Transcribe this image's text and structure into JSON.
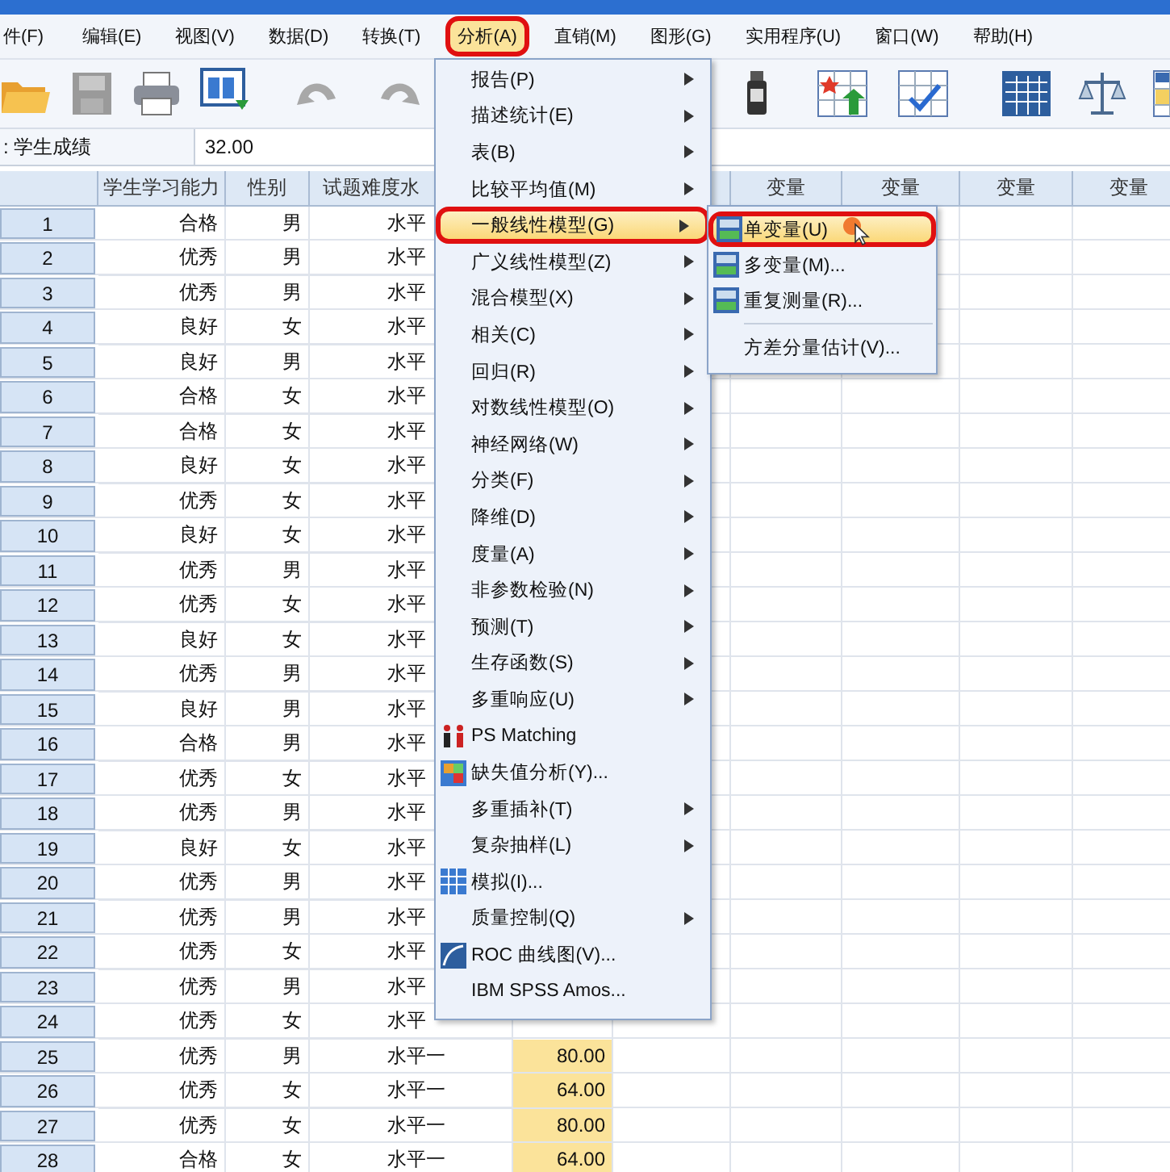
{
  "menubar": [
    {
      "label": "件(F)",
      "selected": false
    },
    {
      "label": "编辑(E)",
      "selected": false
    },
    {
      "label": "视图(V)",
      "selected": false
    },
    {
      "label": "数据(D)",
      "selected": false
    },
    {
      "label": "转换(T)",
      "selected": false
    },
    {
      "label": "分析(A)",
      "selected": true
    },
    {
      "label": "直销(M)",
      "selected": false
    },
    {
      "label": "图形(G)",
      "selected": false
    },
    {
      "label": "实用程序(U)",
      "selected": false
    },
    {
      "label": "窗口(W)",
      "selected": false
    },
    {
      "label": "帮助(H)",
      "selected": false
    }
  ],
  "cell_editor": {
    "name": ": 学生成绩",
    "value": "32.00"
  },
  "table": {
    "columns": [
      "学生学习能力",
      "性别",
      "试题难度水"
    ],
    "score_column": {
      "selected": true
    },
    "variable_columns": [
      "变量",
      "变量",
      "变量",
      "变量"
    ],
    "rows": [
      {
        "number": "1",
        "ability": "合格",
        "gender": "男",
        "difficulty": "水平"
      },
      {
        "number": "2",
        "ability": "优秀",
        "gender": "男",
        "difficulty": "水平"
      },
      {
        "number": "3",
        "ability": "优秀",
        "gender": "男",
        "difficulty": "水平"
      },
      {
        "number": "4",
        "ability": "良好",
        "gender": "女",
        "difficulty": "水平"
      },
      {
        "number": "5",
        "ability": "良好",
        "gender": "男",
        "difficulty": "水平"
      },
      {
        "number": "6",
        "ability": "合格",
        "gender": "女",
        "difficulty": "水平"
      },
      {
        "number": "7",
        "ability": "合格",
        "gender": "女",
        "difficulty": "水平"
      },
      {
        "number": "8",
        "ability": "良好",
        "gender": "女",
        "difficulty": "水平"
      },
      {
        "number": "9",
        "ability": "优秀",
        "gender": "女",
        "difficulty": "水平"
      },
      {
        "number": "10",
        "ability": "良好",
        "gender": "女",
        "difficulty": "水平"
      },
      {
        "number": "11",
        "ability": "优秀",
        "gender": "男",
        "difficulty": "水平"
      },
      {
        "number": "12",
        "ability": "优秀",
        "gender": "女",
        "difficulty": "水平"
      },
      {
        "number": "13",
        "ability": "良好",
        "gender": "女",
        "difficulty": "水平"
      },
      {
        "number": "14",
        "ability": "优秀",
        "gender": "男",
        "difficulty": "水平"
      },
      {
        "number": "15",
        "ability": "良好",
        "gender": "男",
        "difficulty": "水平"
      },
      {
        "number": "16",
        "ability": "合格",
        "gender": "男",
        "difficulty": "水平"
      },
      {
        "number": "17",
        "ability": "优秀",
        "gender": "女",
        "difficulty": "水平"
      },
      {
        "number": "18",
        "ability": "优秀",
        "gender": "男",
        "difficulty": "水平"
      },
      {
        "number": "19",
        "ability": "良好",
        "gender": "女",
        "difficulty": "水平"
      },
      {
        "number": "20",
        "ability": "优秀",
        "gender": "男",
        "difficulty": "水平"
      },
      {
        "number": "21",
        "ability": "优秀",
        "gender": "男",
        "difficulty": "水平"
      },
      {
        "number": "22",
        "ability": "优秀",
        "gender": "女",
        "difficulty": "水平"
      },
      {
        "number": "23",
        "ability": "优秀",
        "gender": "男",
        "difficulty": "水平"
      },
      {
        "number": "24",
        "ability": "优秀",
        "gender": "女",
        "difficulty": "水平"
      },
      {
        "number": "25",
        "ability": "优秀",
        "gender": "男",
        "difficulty": "水平一",
        "score": "80.00"
      },
      {
        "number": "26",
        "ability": "优秀",
        "gender": "女",
        "difficulty": "水平一",
        "score": "64.00"
      },
      {
        "number": "27",
        "ability": "优秀",
        "gender": "女",
        "difficulty": "水平一",
        "score": "80.00"
      },
      {
        "number": "28",
        "ability": "合格",
        "gender": "女",
        "difficulty": "水平一",
        "score": "64.00"
      }
    ]
  },
  "analyze_menu": [
    {
      "label": "报告(P)",
      "kind": "submenu",
      "selected": false
    },
    {
      "label": "描述统计(E)",
      "kind": "submenu",
      "selected": false
    },
    {
      "label": "表(B)",
      "kind": "submenu",
      "selected": false
    },
    {
      "label": "比较平均值(M)",
      "kind": "submenu",
      "selected": false
    },
    {
      "label": "一般线性模型(G)",
      "kind": "submenu",
      "selected": true
    },
    {
      "label": "广义线性模型(Z)",
      "kind": "submenu",
      "selected": false
    },
    {
      "label": "混合模型(X)",
      "kind": "submenu",
      "selected": false
    },
    {
      "label": "相关(C)",
      "kind": "submenu",
      "selected": false
    },
    {
      "label": "回归(R)",
      "kind": "submenu",
      "selected": false
    },
    {
      "label": "对数线性模型(O)",
      "kind": "submenu",
      "selected": false
    },
    {
      "label": "神经网络(W)",
      "kind": "submenu",
      "selected": false
    },
    {
      "label": "分类(F)",
      "kind": "submenu",
      "selected": false
    },
    {
      "label": "降维(D)",
      "kind": "submenu",
      "selected": false
    },
    {
      "label": "度量(A)",
      "kind": "submenu",
      "selected": false
    },
    {
      "label": "非参数检验(N)",
      "kind": "submenu",
      "selected": false
    },
    {
      "label": "预测(T)",
      "kind": "submenu",
      "selected": false
    },
    {
      "label": "生存函数(S)",
      "kind": "submenu",
      "selected": false
    },
    {
      "label": "多重响应(U)",
      "kind": "submenu",
      "selected": false
    },
    {
      "label": "PS Matching",
      "kind": "matching",
      "selected": false
    },
    {
      "label": "缺失值分析(Y)...",
      "kind": "missing",
      "selected": false
    },
    {
      "label": "多重插补(T)",
      "kind": "submenu",
      "selected": false
    },
    {
      "label": "复杂抽样(L)",
      "kind": "submenu",
      "selected": false
    },
    {
      "label": "模拟(I)...",
      "kind": "simulation",
      "selected": false
    },
    {
      "label": "质量控制(Q)",
      "kind": "submenu",
      "selected": false
    },
    {
      "label": "ROC 曲线图(V)...",
      "kind": "roc",
      "selected": false
    },
    {
      "label": "IBM SPSS Amos...",
      "kind": "plain",
      "selected": false
    }
  ],
  "glm_submenu": [
    {
      "label": "单变量(U)",
      "kind": "model",
      "selected": true
    },
    {
      "label": "多变量(M)...",
      "kind": "model",
      "selected": false
    },
    {
      "label": "重复测量(R)...",
      "kind": "model",
      "selected": false
    },
    {
      "label": "方差分量估计(V)...",
      "kind": "plain",
      "selected": false
    }
  ]
}
